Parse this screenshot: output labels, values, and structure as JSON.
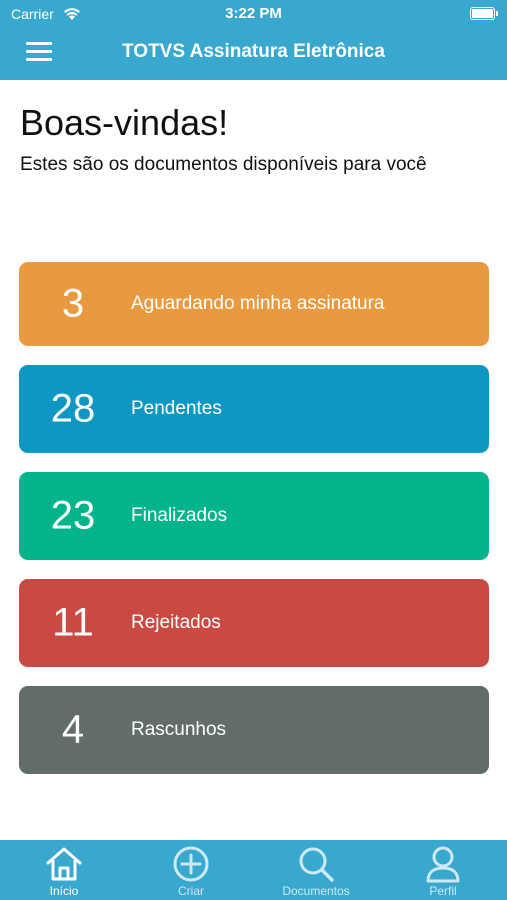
{
  "status_bar": {
    "carrier": "Carrier",
    "time": "3:22 PM"
  },
  "nav": {
    "title": "TOTVS Assinatura Eletrônica",
    "menu_icon": "hamburger-menu-icon"
  },
  "main": {
    "welcome": "Boas-vindas!",
    "subtitle": "Estes são os documentos disponíveis para você",
    "cards": [
      {
        "count": "3",
        "label": "Aguardando minha assinatura",
        "color": "#e99a40"
      },
      {
        "count": "28",
        "label": "Pendentes",
        "color": "#0f97c4"
      },
      {
        "count": "23",
        "label": "Finalizados",
        "color": "#02b48c"
      },
      {
        "count": "11",
        "label": "Rejeitados",
        "color": "#c84a43"
      },
      {
        "count": "4",
        "label": "Rascunhos",
        "color": "#616c6b"
      }
    ]
  },
  "tabbar": {
    "tabs": [
      {
        "label": "Início",
        "icon": "home-icon",
        "active": true
      },
      {
        "label": "Criar",
        "icon": "plus-circle-icon",
        "active": false
      },
      {
        "label": "Documentos",
        "icon": "search-icon",
        "active": false
      },
      {
        "label": "Perfil",
        "icon": "user-icon",
        "active": false
      }
    ]
  },
  "colors": {
    "brand": "#39a8cf",
    "text": "#111111"
  }
}
